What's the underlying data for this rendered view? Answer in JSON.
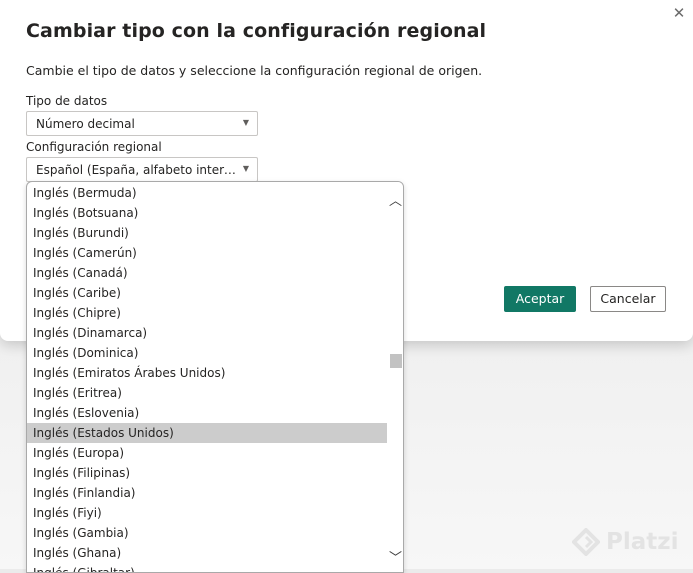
{
  "dialog": {
    "title": "Cambiar tipo con la configuración regional",
    "description": "Cambie el tipo de datos y seleccione la configuración regional de origen.",
    "close_icon": "close-icon",
    "data_type_label": "Tipo de datos",
    "data_type_value": "Número decimal",
    "locale_label": "Configuración regional",
    "locale_value": "Español (España, alfabeto internacio...",
    "ok_label": "Aceptar",
    "cancel_label": "Cancelar"
  },
  "dropdown": {
    "items": [
      "Inglés (Bermuda)",
      "Inglés (Botsuana)",
      "Inglés (Burundi)",
      "Inglés (Camerún)",
      "Inglés (Canadá)",
      "Inglés (Caribe)",
      "Inglés (Chipre)",
      "Inglés (Dinamarca)",
      "Inglés (Dominica)",
      "Inglés (Emiratos Árabes Unidos)",
      "Inglés (Eritrea)",
      "Inglés (Eslovenia)",
      "Inglés (Estados Unidos)",
      "Inglés (Europa)",
      "Inglés (Filipinas)",
      "Inglés (Finlandia)",
      "Inglés (Fiyi)",
      "Inglés (Gambia)",
      "Inglés (Ghana)",
      "Inglés (Gibraltar)"
    ],
    "selected": "Inglés (Estados Unidos)"
  },
  "watermark": {
    "text": "Platzi"
  },
  "colors": {
    "accent": "#117865",
    "selection": "#cccccc"
  }
}
